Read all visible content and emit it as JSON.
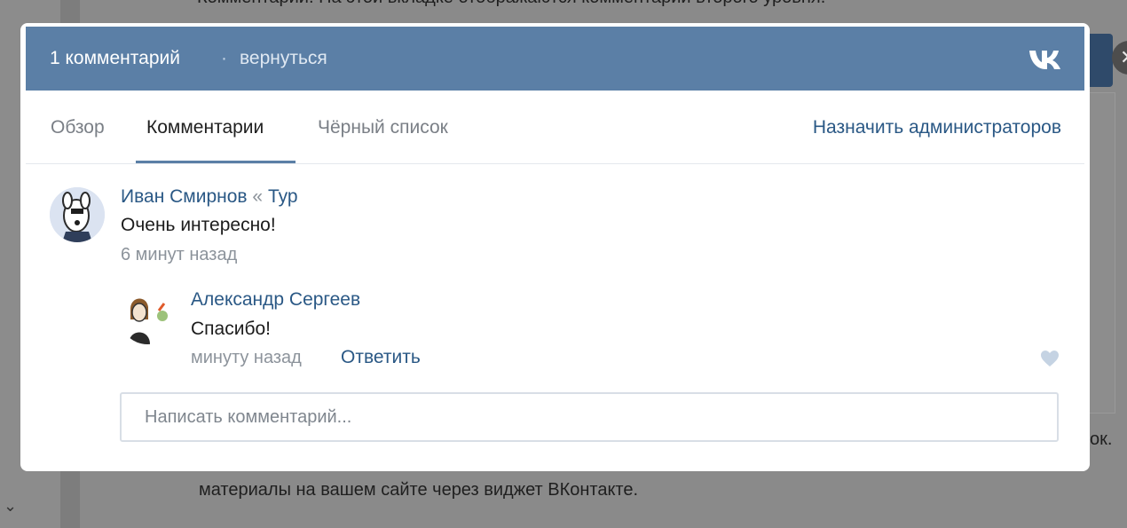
{
  "background": {
    "top_text": "Комментарии. На этой вкладке отображаются комментарии второго уровня.",
    "right_fragment": "ок.",
    "bottom_line": "материалы на вашем сайте через виджет ВКонтакте."
  },
  "modal": {
    "header": {
      "title": "1 комментарий",
      "separator": "·",
      "back_label": "вернуться",
      "logo_icon": "vk-logo-icon"
    },
    "tabs": [
      {
        "label": "Обзор",
        "active": false
      },
      {
        "label": "Комментарии",
        "active": true
      },
      {
        "label": "Чёрный список",
        "active": false
      }
    ],
    "admins_link": "Назначить администраторов",
    "comments": [
      {
        "author": "Иван Смирнов",
        "context_separator": "«",
        "context": "Тур",
        "text": "Очень интересно!",
        "time": "6 минут назад"
      }
    ],
    "replies": [
      {
        "author": "Александр Сергеев",
        "text": "Спасибо!",
        "time": "минуту назад",
        "reply_label": "Ответить",
        "like_icon": "heart-icon"
      }
    ],
    "input": {
      "placeholder": "Написать комментарий..."
    }
  },
  "colors": {
    "header": "#5b7fa6",
    "link": "#2a5885",
    "overlay": "#8a8a8a"
  }
}
